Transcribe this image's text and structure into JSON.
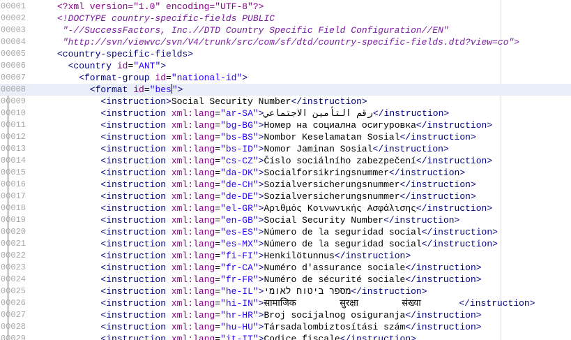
{
  "editor": {
    "current_line_index": 7,
    "lines": [
      {
        "n": "00001",
        "indent": 0,
        "kind": "xmldecl",
        "text": "<?xml version=\"1.0\" encoding=\"UTF-8\"?>"
      },
      {
        "n": "00002",
        "indent": 0,
        "kind": "doctype",
        "text": "<!DOCTYPE country-specific-fields PUBLIC"
      },
      {
        "n": "00003",
        "indent": 1,
        "kind": "doctype",
        "text": "\"-//SuccessFactors, Inc.//DTD Country Specific Field Configuration//EN\""
      },
      {
        "n": "00004",
        "indent": 1,
        "kind": "doctype",
        "text": "\"http://svn/viewvc/svn/V4/trunk/src/com/sf/dtd/country-specific-fields.dtd?view=co\">"
      },
      {
        "n": "00005",
        "indent": 0,
        "kind": "open",
        "tag": "country-specific-fields"
      },
      {
        "n": "00006",
        "indent": 2,
        "kind": "open",
        "tag": "country",
        "attr": "id",
        "val": "ANT"
      },
      {
        "n": "00007",
        "indent": 4,
        "kind": "open",
        "tag": "format-group",
        "attr": "id",
        "val": "national-id"
      },
      {
        "n": "00008",
        "indent": 6,
        "kind": "open",
        "tag": "format",
        "attr": "id",
        "val": "bes",
        "caret": true
      },
      {
        "n": "00009",
        "indent": 8,
        "kind": "instr",
        "text": "Social Security Number"
      },
      {
        "n": "00010",
        "indent": 8,
        "kind": "instr",
        "lang": "ar-SA",
        "text": "رقم التأمين الاجتماعي"
      },
      {
        "n": "00011",
        "indent": 8,
        "kind": "instr",
        "lang": "bg-BG",
        "text": "Номер на социална осигуровка"
      },
      {
        "n": "00012",
        "indent": 8,
        "kind": "instr",
        "lang": "bs-BS",
        "text": "Nombor Keselamatan Sosial"
      },
      {
        "n": "00013",
        "indent": 8,
        "kind": "instr",
        "lang": "bs-ID",
        "text": "Nomor Jaminan Sosial"
      },
      {
        "n": "00014",
        "indent": 8,
        "kind": "instr",
        "lang": "cs-CZ",
        "text": "Číslo sociálního zabezpečení"
      },
      {
        "n": "00015",
        "indent": 8,
        "kind": "instr",
        "lang": "da-DK",
        "text": "Socialforsikringsnummer"
      },
      {
        "n": "00016",
        "indent": 8,
        "kind": "instr",
        "lang": "de-CH",
        "text": "Sozialversicherungsnummer"
      },
      {
        "n": "00017",
        "indent": 8,
        "kind": "instr",
        "lang": "de-DE",
        "text": "Sozialversicherungsnummer"
      },
      {
        "n": "00018",
        "indent": 8,
        "kind": "instr",
        "lang": "el-GR",
        "text": "Αριθμός Κοινωνικής Ασφάλισης"
      },
      {
        "n": "00019",
        "indent": 8,
        "kind": "instr",
        "lang": "en-GB",
        "text": "Social Security Number"
      },
      {
        "n": "00020",
        "indent": 8,
        "kind": "instr",
        "lang": "es-ES",
        "text": "Número de la seguridad social"
      },
      {
        "n": "00021",
        "indent": 8,
        "kind": "instr",
        "lang": "es-MX",
        "text": "Número de la seguridad social"
      },
      {
        "n": "00022",
        "indent": 8,
        "kind": "instr",
        "lang": "fi-FI",
        "text": "Henkilötunnus"
      },
      {
        "n": "00023",
        "indent": 8,
        "kind": "instr",
        "lang": "fr-CA",
        "text": "Numéro d'assurance sociale"
      },
      {
        "n": "00024",
        "indent": 8,
        "kind": "instr",
        "lang": "fr-FR",
        "text": "Numéro de sécurité sociale"
      },
      {
        "n": "00025",
        "indent": 8,
        "kind": "instr",
        "lang": "he-IL",
        "text": "מספר ביטוח לאומי"
      },
      {
        "n": "00026",
        "indent": 8,
        "kind": "instr",
        "lang": "hi-IN",
        "text": "सामाजिक        सुरक्षा        संख्या       "
      },
      {
        "n": "00027",
        "indent": 8,
        "kind": "instr",
        "lang": "hr-HR",
        "text": "Broj socijalnog osiguranja"
      },
      {
        "n": "00028",
        "indent": 8,
        "kind": "instr",
        "lang": "hu-HU",
        "text": "Társadalombiztosítási szám"
      },
      {
        "n": "00029",
        "indent": 8,
        "kind": "instr",
        "lang": "it-IT",
        "text": "Codice fiscale"
      }
    ]
  }
}
